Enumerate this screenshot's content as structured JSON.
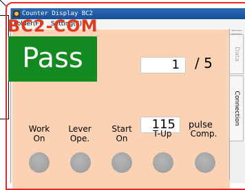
{
  "window": {
    "title": "Counter Display BC2"
  },
  "menu": {
    "items": [
      "Folder(F)",
      "Setting(S)"
    ]
  },
  "panel": {
    "brand": "BC2-COM",
    "status": "Pass",
    "count": "1",
    "total": "/ 5",
    "pulse_value": "115",
    "pulse_unit": "pulse"
  },
  "signals": [
    {
      "line1": "Work",
      "line2": "On"
    },
    {
      "line1": "Lever",
      "line2": "Ope."
    },
    {
      "line1": "Start",
      "line2": "On"
    },
    {
      "line1": "T-Up",
      "line2": ""
    },
    {
      "line1": "Comp.",
      "line2": ""
    }
  ],
  "side_tabs": {
    "data": "Data",
    "connection": "Connection"
  },
  "colors": {
    "panel": "#fbd3b4",
    "pass": "#138a1f",
    "brand": "#e23a1c",
    "frame": "#e8262a"
  }
}
